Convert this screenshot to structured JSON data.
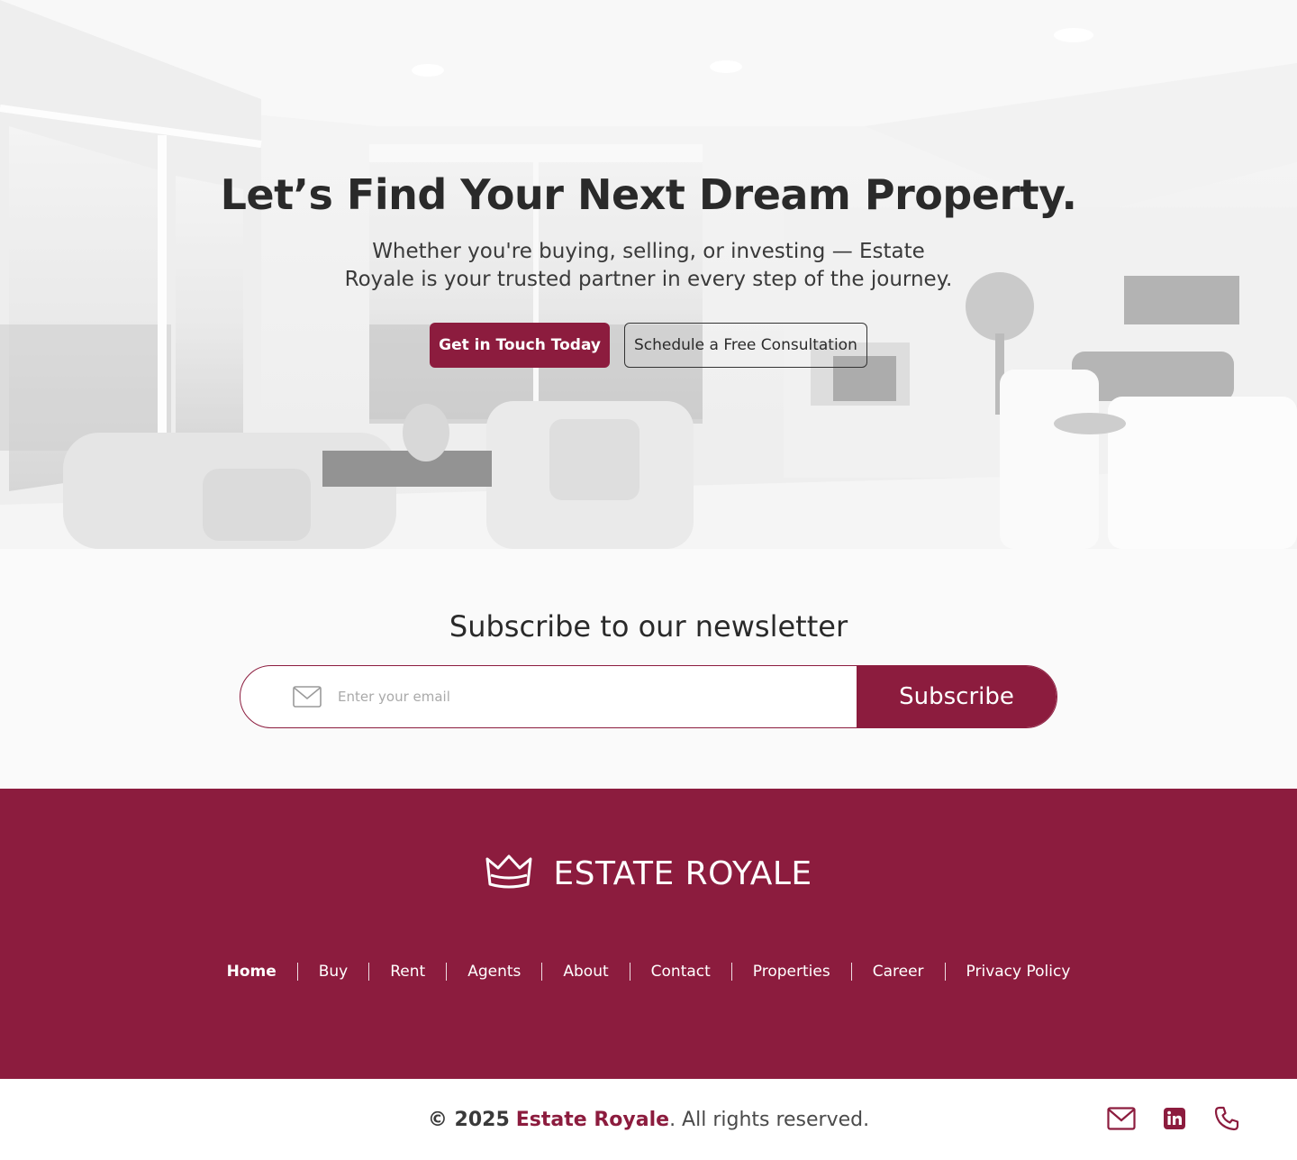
{
  "hero": {
    "title": "Let’s Find Your Next Dream Property.",
    "subtitle": "Whether you're buying, selling, or investing — Estate Royale is your trusted partner in every step of the journey.",
    "primary_cta": "Get in Touch Today",
    "secondary_cta": "Schedule a Free Consultation"
  },
  "newsletter": {
    "title": "Subscribe to our newsletter",
    "email_placeholder": "Enter your email",
    "email_icon": "mail-icon",
    "submit_label": "Subscribe"
  },
  "footer": {
    "logo_icon": "crown-icon",
    "brand_name": "ESTATE ROYALE",
    "nav": [
      "Home",
      "Buy",
      "Rent",
      "Agents",
      "About",
      "Contact",
      "Properties",
      "Career",
      "Privacy Policy"
    ],
    "active_nav": "Home"
  },
  "bottom": {
    "copyright_prefix": "© 2025",
    "copyright_brand": "Estate Royale",
    "copyright_suffix": ". All rights reserved.",
    "social_icons": [
      "mail-icon",
      "linkedin-icon",
      "phone-icon"
    ]
  },
  "colors": {
    "brand": "#8c1c3e",
    "text": "#2b2b2b",
    "background": "#fafafa"
  }
}
